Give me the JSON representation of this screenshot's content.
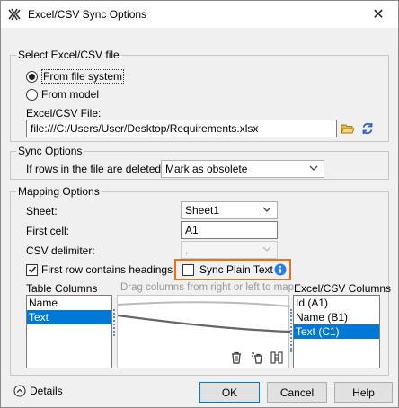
{
  "window": {
    "title": "Excel/CSV Sync Options"
  },
  "icons": {
    "app": "magicdraw-app-icon",
    "close": "close-icon",
    "folder": "open-folder-icon",
    "refresh": "refresh-icon",
    "info": "info-icon",
    "delete": "delete-icon",
    "delete_all": "delete-all-icon",
    "auto_map": "auto-map-icon",
    "details": "expand-circle-icon"
  },
  "colors": {
    "accent": "#0078d7",
    "highlight": "#e8711c"
  },
  "select_file": {
    "group_title": "Select Excel/CSV file",
    "option_file_system": "From file system",
    "option_model": "From model",
    "file_label": "Excel/CSV File:",
    "file_value": "file:///C:/Users/User/Desktop/Requirements.xlsx"
  },
  "sync_options": {
    "group_title": "Sync Options",
    "deleted_label": "If rows in the file are deleted:",
    "deleted_value": "Mark as obsolete"
  },
  "mapping": {
    "group_title": "Mapping Options",
    "sheet_label": "Sheet:",
    "sheet_value": "Sheet1",
    "first_cell_label": "First cell:",
    "first_cell_value": "A1",
    "csv_delimiter_label": "CSV delimiter:",
    "csv_delimiter_value": ",",
    "headings_label": "First row contains headings",
    "sync_plain_text_label": "Sync Plain Text",
    "table_columns_title": "Table Columns",
    "table_columns": [
      "Name",
      "Text"
    ],
    "drag_hint": "Drag columns from right or left to map",
    "excel_columns_title": "Excel/CSV Columns",
    "excel_columns": [
      "Id (A1)",
      "Name (B1)",
      "Text (C1)"
    ]
  },
  "footer": {
    "details_label": "Details",
    "ok_label": "OK",
    "cancel_label": "Cancel",
    "help_label": "Help"
  }
}
